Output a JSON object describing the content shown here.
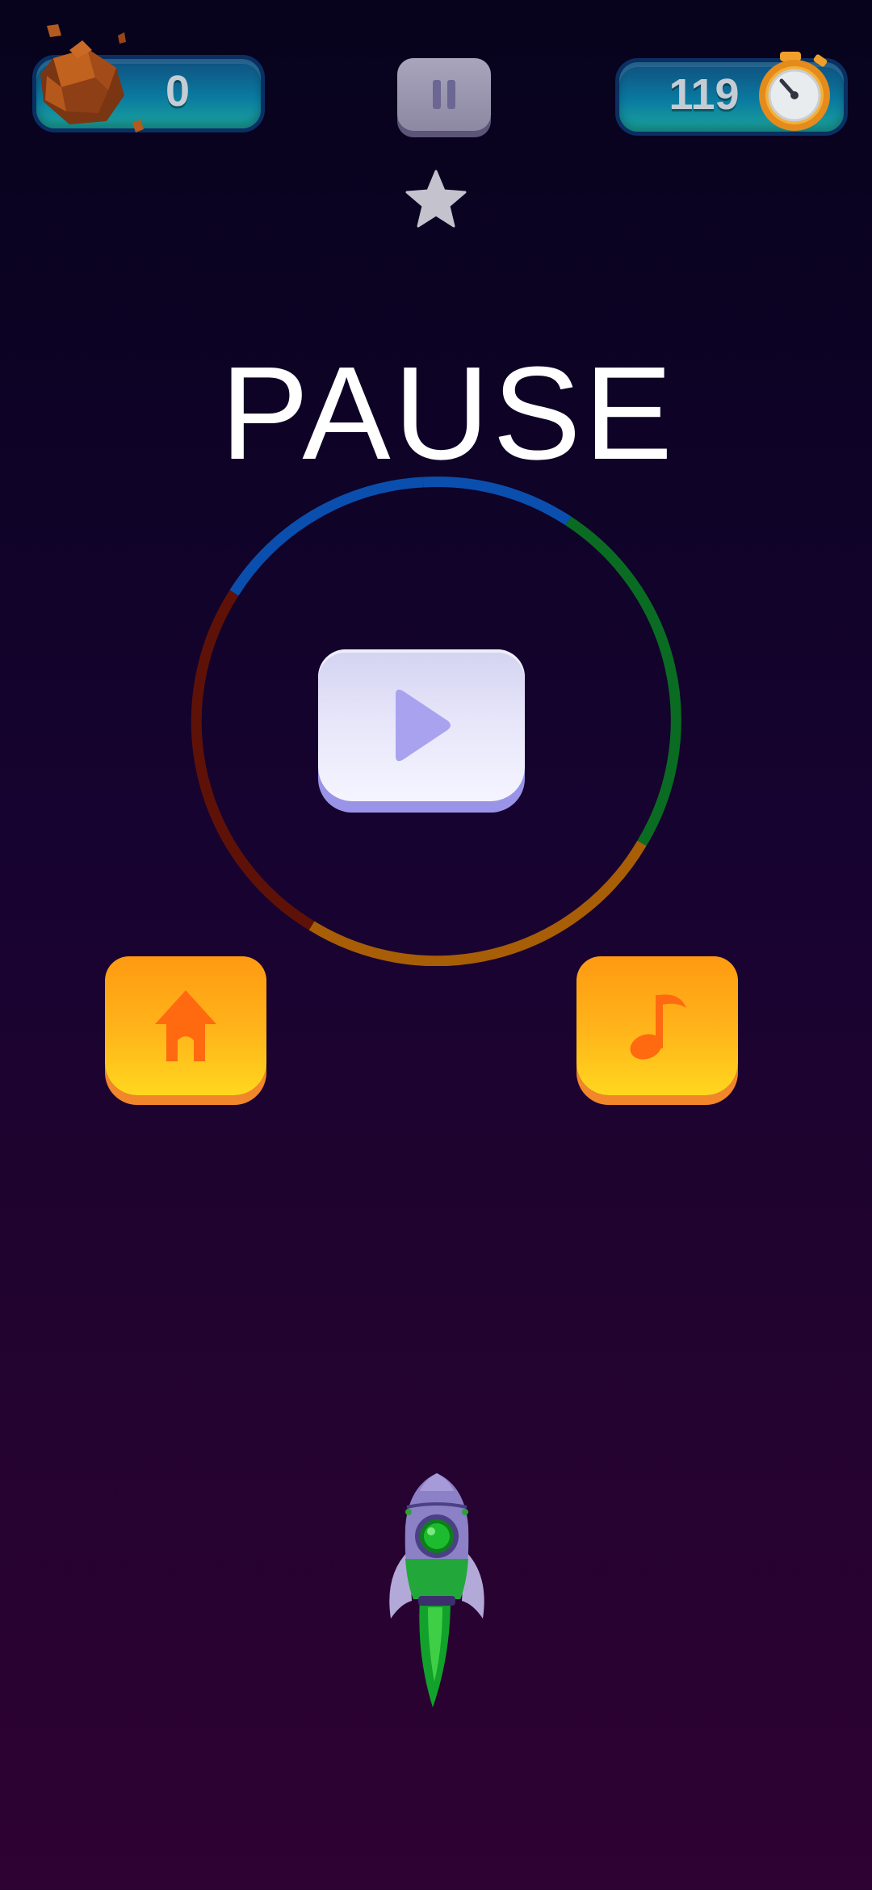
{
  "hud": {
    "score": "0",
    "score_icon": "asteroid-icon",
    "pause_icon": "pause-icon",
    "timer": "119",
    "timer_icon": "stopwatch-icon",
    "star_icon": "star-icon"
  },
  "pause_menu": {
    "title": "PAUSE",
    "play_icon": "play-icon",
    "home_icon": "home-icon",
    "music_icon": "music-note-icon",
    "ring_colors": [
      "#0a4fae",
      "#0a6c22",
      "#a85e06",
      "#5e1207"
    ]
  },
  "player": {
    "sprite": "rocket-icon",
    "accent_color": "#12a12a"
  },
  "colors": {
    "background_top": "#07031c",
    "background_bottom": "#2e0233",
    "hud_pill": "#0a7aa0",
    "orange_button": "#ffb51a",
    "play_button": "#e8e7fa"
  }
}
